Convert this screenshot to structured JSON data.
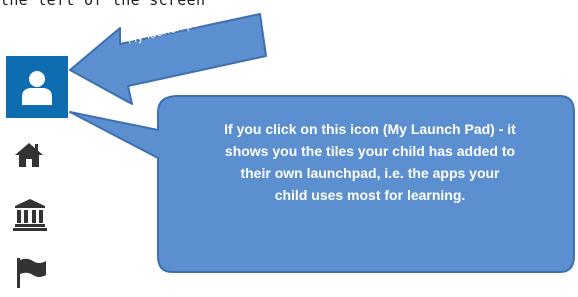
{
  "header": {
    "text": "the left of the screen"
  },
  "arrow": {
    "label": "My launch pad"
  },
  "callout": {
    "lines": [
      "If you click on this icon (My Launch Pad) - it",
      "shows you the tiles your child has added to",
      "their own launchpad, i.e. the apps your",
      "child uses most for learning."
    ]
  },
  "sidebar": {
    "items": [
      {
        "icon": "user-icon",
        "active": true
      },
      {
        "icon": "home-icon"
      },
      {
        "icon": "institution-icon"
      },
      {
        "icon": "flag-icon"
      }
    ]
  },
  "colors": {
    "active_bg": "#0e6db1",
    "callout_fill": "#5b8fd0",
    "callout_border": "#3f70b0",
    "icon": "#333333"
  }
}
